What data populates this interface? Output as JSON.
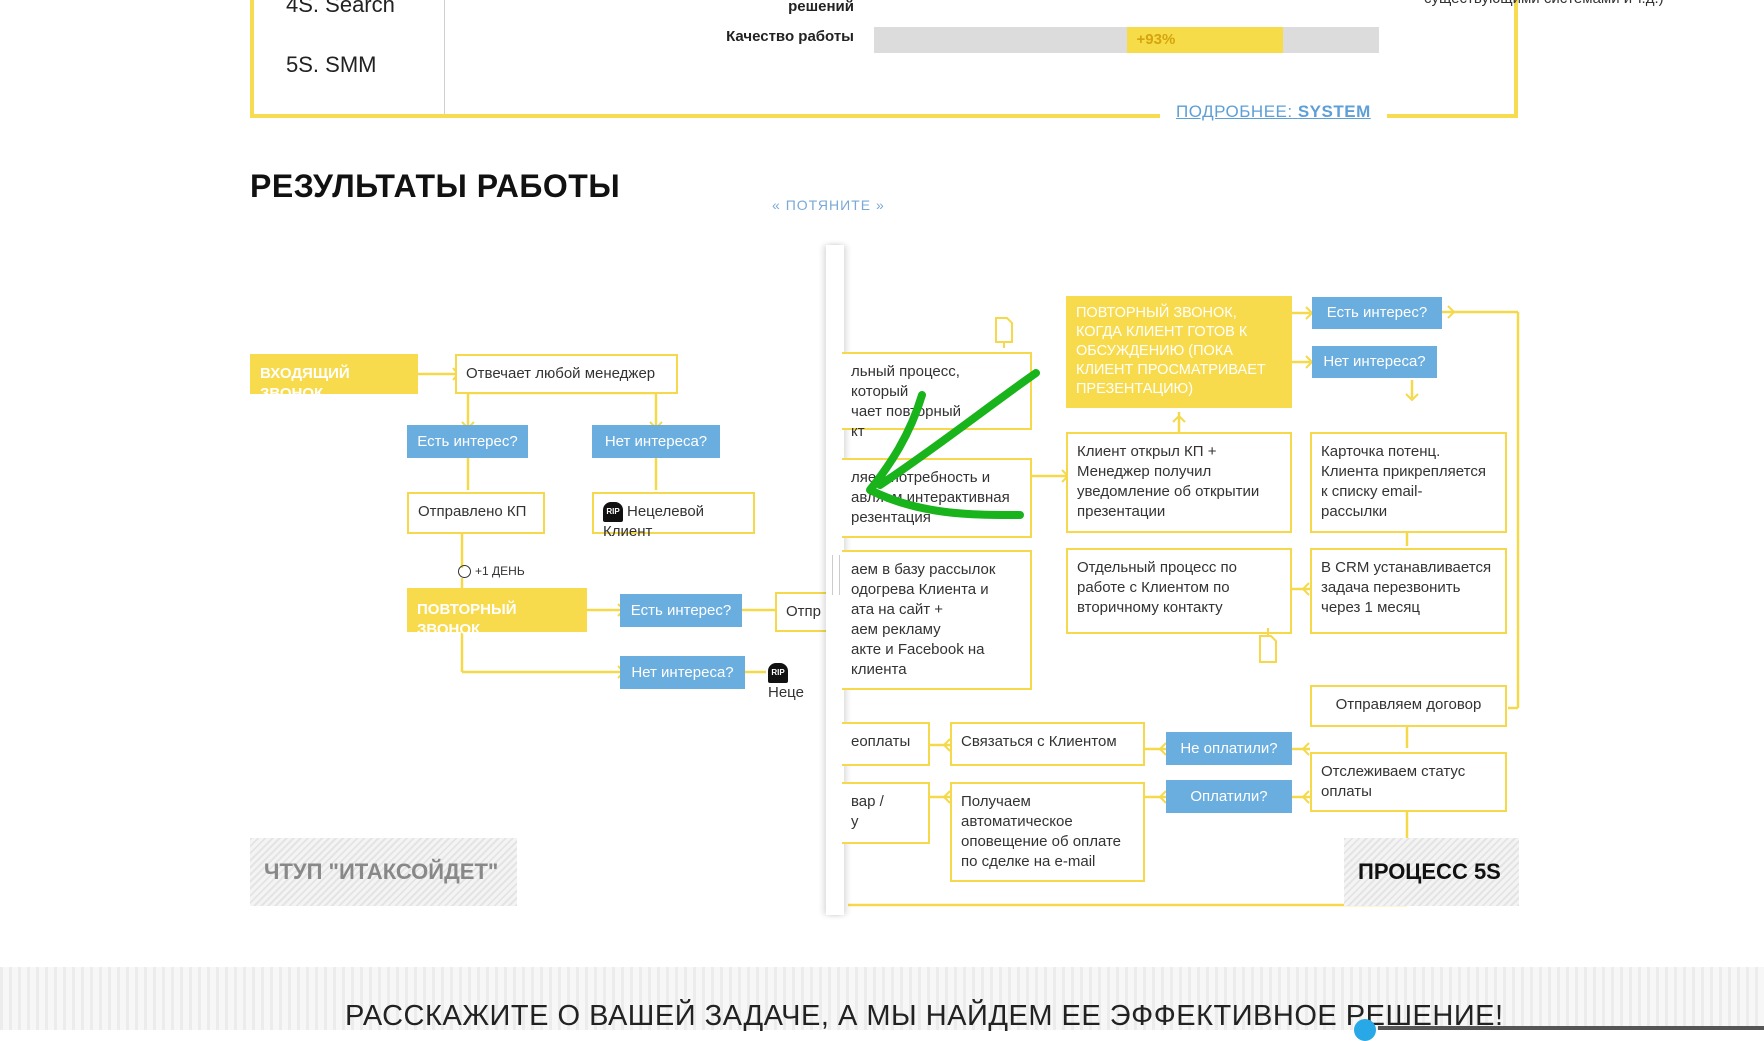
{
  "top": {
    "sidebar": [
      {
        "num": "4S.",
        "label": "Search"
      },
      {
        "num": "5S.",
        "label": "SMM"
      }
    ],
    "metrics": [
      {
        "label": "решений"
      },
      {
        "label": "Качество работы",
        "value": "+93%",
        "fill_start_pct": 50,
        "fill_pct": 81
      }
    ],
    "note": "программных продуктов, синхронизация с существующими системами и т.д.)",
    "more_prefix": "ПОДРОБНЕЕ:",
    "more_link": "SYSTEM"
  },
  "section_title": "РЕЗУЛЬТАТЫ РАБОТЫ",
  "drag_hint": "ПОТЯНИТЕ",
  "left_flow": {
    "incoming": "ВХОДЯЩИЙ ЗВОНОК",
    "any_manager": "Отвечает любой менеджер",
    "interest1": "Есть интерес?",
    "no_interest1": "Нет интереса?",
    "sent_kp": "Отправлено КП",
    "non_target1": "Нецелевой Клиент",
    "day_timer": "+1 ДЕНЬ",
    "repeat_call": "ПОВТОРНЫЙ ЗВОНОК",
    "interest2": "Есть интерес?",
    "sent_cut": "Отпр",
    "no_interest2": "Нет интереса?",
    "non_target2": "Неце",
    "rip": "RIP"
  },
  "right_flow": {
    "separate_process": "льный процесс, который\nчает повторный\nкт",
    "need_interactive": "ляем потребность и\nавляем интерактивная\nрезентация",
    "mailing_base": "аем в базу рассылок\nодогрева Клиента и\nата на сайт +\nаем рекламу\nакте и Facebook на\nклиента",
    "repeat_call_ready": "ПОВТОРНЫЙ ЗВОНОК, КОГДА КЛИЕНТ ГОТОВ К ОБСУЖДЕНИЮ (ПОКА КЛИЕНТ ПРОСМАТРИВАЕТ ПРЕЗЕНТАЦИЮ)",
    "interest": "Есть интерес?",
    "no_interest": "Нет интереса?",
    "client_opened": "Клиент открыл КП +\nМенеджер получил\nуведомление об открытии\nпрезентации",
    "card": "Карточка потенц.\nКлиента прикрепляется\nк списку email-\nрассылки",
    "secondary": "Отдельный процесс по\nработе с Клиентом по\nвторичному контакту",
    "crm_task": "В CRM устанавливается\nзадача перезвонить\nчерез 1 месяц",
    "send_contract": "Отправляем договор",
    "non_payment": "еоплаты",
    "contact_client": "Связаться с Клиентом",
    "not_paid": "Не оплатили?",
    "track_status": "Отслеживаем статус\nоплаты",
    "goods": "вар /\nу",
    "auto_notice": "Получаем\nавтоматическое\nоповещение об оплате\nпо сделке на e-mail",
    "paid": "Оплатили?"
  },
  "case_left": "ЧТУП \"ИТАКСОЙДЕТ\"",
  "case_right": "ПРОЦЕСС 5S",
  "footer_text": "РАССКАЖИТЕ О ВАШЕЙ ЗАДАЧЕ, А МЫ НАЙДЕМ ЕЕ ЭФФЕКТИВНОЕ РЕШЕНИЕ!",
  "colors": {
    "yellow": "#f8db4d",
    "blue": "#6aaee0",
    "green": "#19b31c",
    "link": "#5d9fd6"
  }
}
